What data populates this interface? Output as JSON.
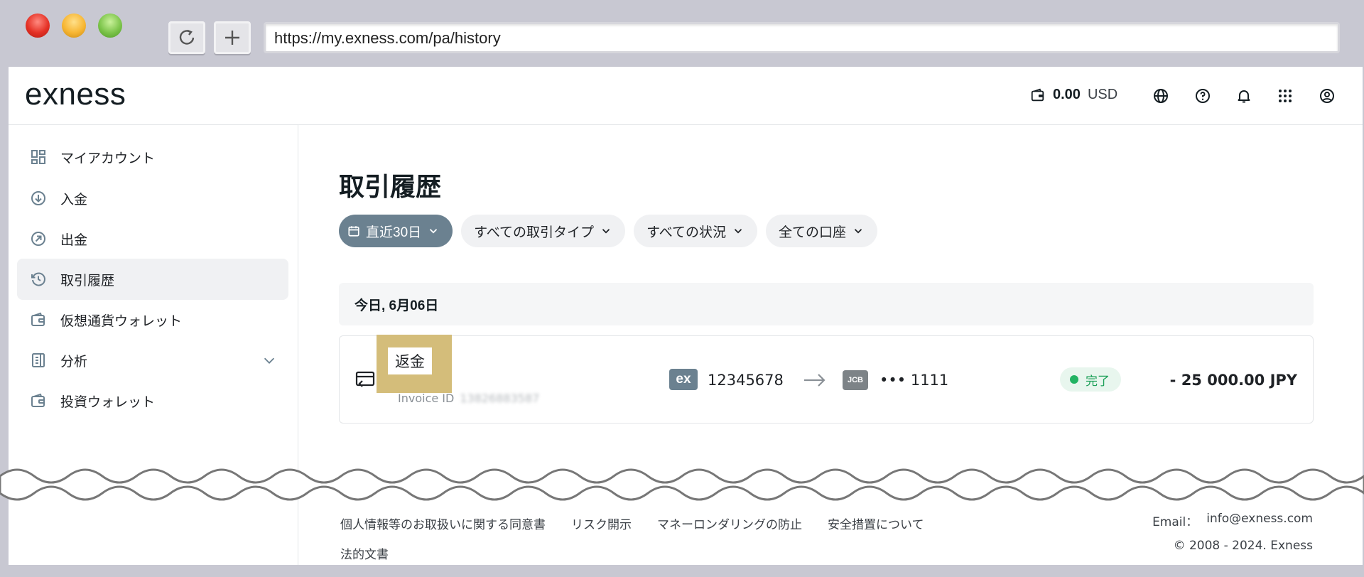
{
  "browser": {
    "url": "https://my.exness.com/pa/history"
  },
  "header": {
    "logo": "exness",
    "balance_amount": "0.00",
    "balance_currency": "USD",
    "icons": [
      "wallet-icon",
      "globe-icon",
      "help-icon",
      "bell-icon",
      "apps-icon",
      "profile-icon"
    ]
  },
  "sidebar": {
    "items": [
      {
        "label": "マイアカウント",
        "icon": "dashboard-icon"
      },
      {
        "label": "入金",
        "icon": "deposit-icon"
      },
      {
        "label": "出金",
        "icon": "withdraw-icon"
      },
      {
        "label": "取引履歴",
        "icon": "history-icon",
        "active": true
      },
      {
        "label": "仮想通貨ウォレット",
        "icon": "wallet-icon"
      },
      {
        "label": "分析",
        "icon": "analytics-icon",
        "expandable": true
      },
      {
        "label": "投資ウォレット",
        "icon": "wallet-icon"
      }
    ]
  },
  "main": {
    "title": "取引履歴",
    "filters": [
      {
        "label": "直近30日",
        "active": true
      },
      {
        "label": "すべての取引タイプ"
      },
      {
        "label": "すべての状況"
      },
      {
        "label": "全ての口座"
      }
    ],
    "date_group": "今日, 6月06日",
    "transaction": {
      "type": "返金",
      "invoice_label": "Invoice ID",
      "invoice_id": "13826883587",
      "from_badge": "ex",
      "from_account": "12345678",
      "to_badge": "JCB",
      "to_account": "••• 1111",
      "status": "完了",
      "amount": "- 25 000.00 JPY"
    }
  },
  "footer": {
    "links": [
      "個人情報等のお取扱いに関する同意書",
      "リスク開示",
      "マネーロンダリングの防止",
      "安全措置について"
    ],
    "legal": "法的文書",
    "email_label": "Email：",
    "email": "info@exness.com",
    "copyright": "© 2008 - 2024. Exness"
  },
  "colors": {
    "accent": "#6b8190",
    "status_green": "#22b363",
    "highlight": "#d4bd7a",
    "active_nav_bg": "#f0f1f3"
  }
}
